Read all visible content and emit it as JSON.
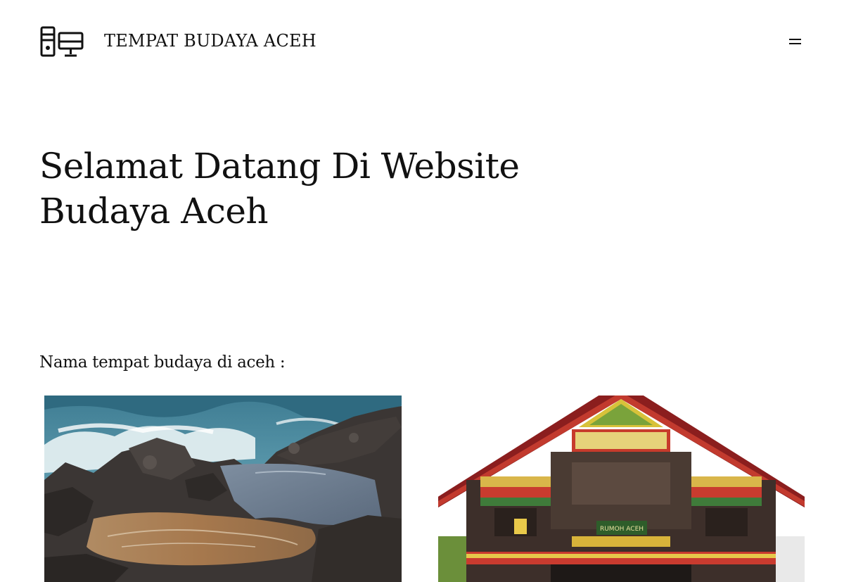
{
  "header": {
    "site_title": "TEMPAT BUDAYA ACEH",
    "logo_icon": "computer-desktop-icon",
    "menu_icon": "hamburger-menu-icon"
  },
  "main": {
    "hero_title": "Selamat Datang Di Website Budaya Aceh",
    "section_label": "Nama tempat budaya di aceh :",
    "gallery": [
      {
        "image": "rocky-coast-tidal-pool-photo"
      },
      {
        "image": "rumoh-aceh-traditional-house-photo",
        "sign_text": "RUMOH ACEH"
      }
    ]
  }
}
